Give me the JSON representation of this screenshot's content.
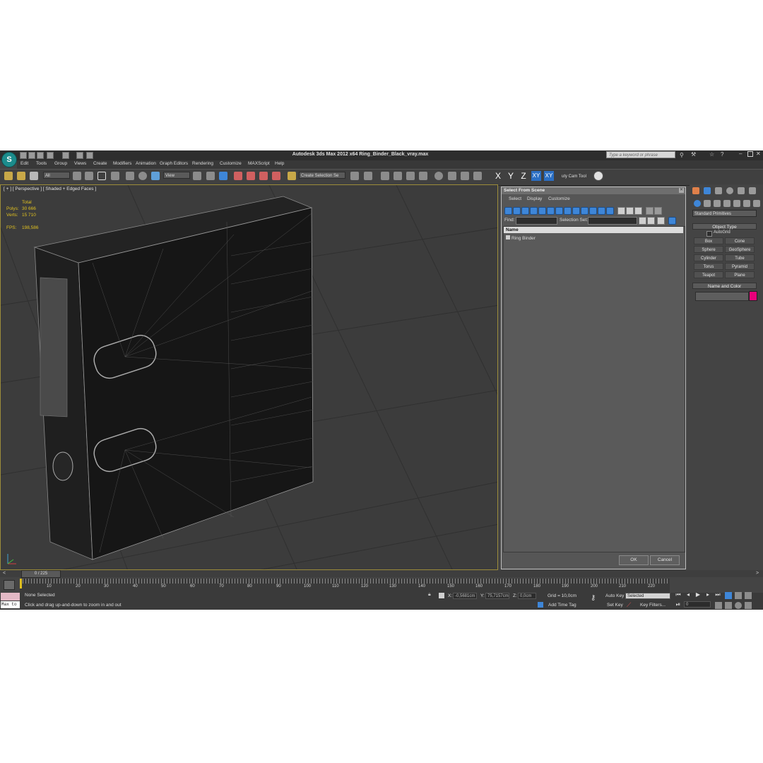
{
  "app": {
    "title": "Autodesk 3ds Max  2012 x64     Ring_Binder_Black_vray.max",
    "search_placeholder": "Type a keyword or phrase",
    "menu": [
      "Edit",
      "Tools",
      "Group",
      "Views",
      "Create",
      "Modifiers",
      "Animation",
      "Graph Editors",
      "Rendering",
      "Customize",
      "MAXScript",
      "Help"
    ]
  },
  "toolbar": {
    "selection_filter": "All",
    "reference_coord": "View",
    "named_selection": "Create Selection Se",
    "axes": [
      "X",
      "Y",
      "Z",
      "XY",
      "XY"
    ],
    "cam_tool": "uty Cam Tool"
  },
  "viewport": {
    "label": "[ + ] [ Perspective ] [ Shaded + Edged Faces ]",
    "stats": {
      "total_label": "Total",
      "polys_label": "Polys:",
      "polys": "30 666",
      "verts_label": "Verts:",
      "verts": "15 710",
      "fps_label": "FPS:",
      "fps": "198,586"
    }
  },
  "dialog": {
    "title": "Select From Scene",
    "menu": [
      "Select",
      "Display",
      "Customize"
    ],
    "find_label": "Find:",
    "selection_set_label": "Selection Set:",
    "column_name": "Name",
    "items": [
      "Ring Binder"
    ],
    "ok_label": "OK",
    "cancel_label": "Cancel"
  },
  "command_panel": {
    "category": "Standard Primitives",
    "object_type_label": "Object Type",
    "autogrid_label": "AutoGrid",
    "primitives": [
      "Box",
      "Cone",
      "Sphere",
      "GeoSphere",
      "Cylinder",
      "Tube",
      "Torus",
      "Pyramid",
      "Teapot",
      "Plane"
    ],
    "name_color_label": "Name and Color",
    "color": "#e8007a"
  },
  "timeline": {
    "slider": "0 / 225",
    "ticks": [
      "10",
      "20",
      "30",
      "40",
      "50",
      "60",
      "70",
      "80",
      "90",
      "100",
      "110",
      "120",
      "130",
      "140",
      "150",
      "160",
      "170",
      "180",
      "190",
      "200",
      "210",
      "220"
    ]
  },
  "status": {
    "selection": "None Selected",
    "prompt": "Click and drag up-and-down to zoom in and out",
    "maxscript": "Max to",
    "x_label": "X:",
    "x_value": "-0,5681cm",
    "y_label": "Y:",
    "y_value": "75,7157cm",
    "z_label": "Z:",
    "z_value": "0,0cm",
    "grid": "Grid = 10,0cm",
    "add_time_tag": "Add Time Tag",
    "auto_key": "Auto Key",
    "key_mode": "Selected",
    "set_key": "Set Key",
    "key_filters": "Key Filters...",
    "frame": "0"
  }
}
